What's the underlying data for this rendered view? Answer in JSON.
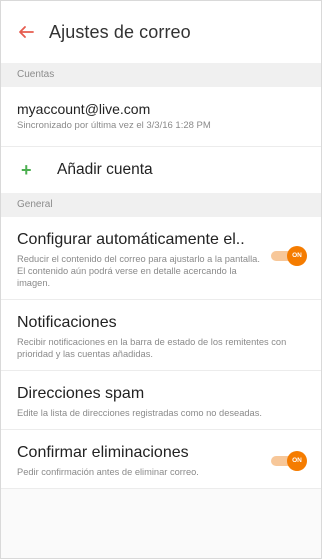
{
  "header": {
    "title": "Ajustes de correo",
    "back_icon": "arrow-left-icon",
    "accent_color": "#e65c4f"
  },
  "sections": {
    "accounts_label": "Cuentas",
    "general_label": "General"
  },
  "account": {
    "email": "myaccount@live.com",
    "sync_status": "Sincronizado por última vez el 3/3/16 1:28 PM"
  },
  "add_account": {
    "icon": "plus-icon",
    "label": "Añadir cuenta",
    "icon_color": "#4caf50"
  },
  "settings": [
    {
      "title": "Configurar automáticamente el..",
      "description": "Reducir el contenido del correo para ajustarlo a la pantalla. El contenido aún podrá verse en detalle acercando la imagen.",
      "toggle": "ON"
    },
    {
      "title": "Notificaciones",
      "description": "Recibir notificaciones en la barra de estado de los remitentes con prioridad y las cuentas añadidas."
    },
    {
      "title": "Direcciones spam",
      "description": "Edite la lista de direcciones registradas como no deseadas."
    },
    {
      "title": "Confirmar eliminaciones",
      "description": "Pedir confirmación antes de eliminar correo.",
      "toggle": "ON"
    }
  ],
  "colors": {
    "toggle_on": "#f57c00",
    "toggle_track": "#f7c799"
  }
}
